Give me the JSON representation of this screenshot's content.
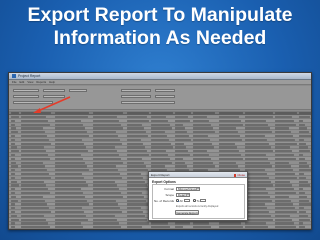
{
  "headline": {
    "line1": "Export Report To Manipulate",
    "line2": "Information As Needed"
  },
  "app": {
    "window_title": "Project Report",
    "toolbar": [
      "File",
      "Edit",
      "View",
      "Reports",
      "Help"
    ]
  },
  "dialog": {
    "title": "Export Report",
    "close_label": "Close",
    "group_label": "Export Options",
    "format_label": "Format",
    "format_value": "Microsoft Excel",
    "scope_label": "Scope",
    "scope_value": "Detail",
    "no_of_records_label": "No. of Records",
    "all_label": "All",
    "to_label": "To",
    "note": "Exports all records currently displayed",
    "button_label": "Generate Export"
  },
  "colors": {
    "background": "#1f66b8",
    "headline": "#ffffff",
    "arrow": "#e43c2a",
    "dialog_bg": "#ffffff"
  }
}
